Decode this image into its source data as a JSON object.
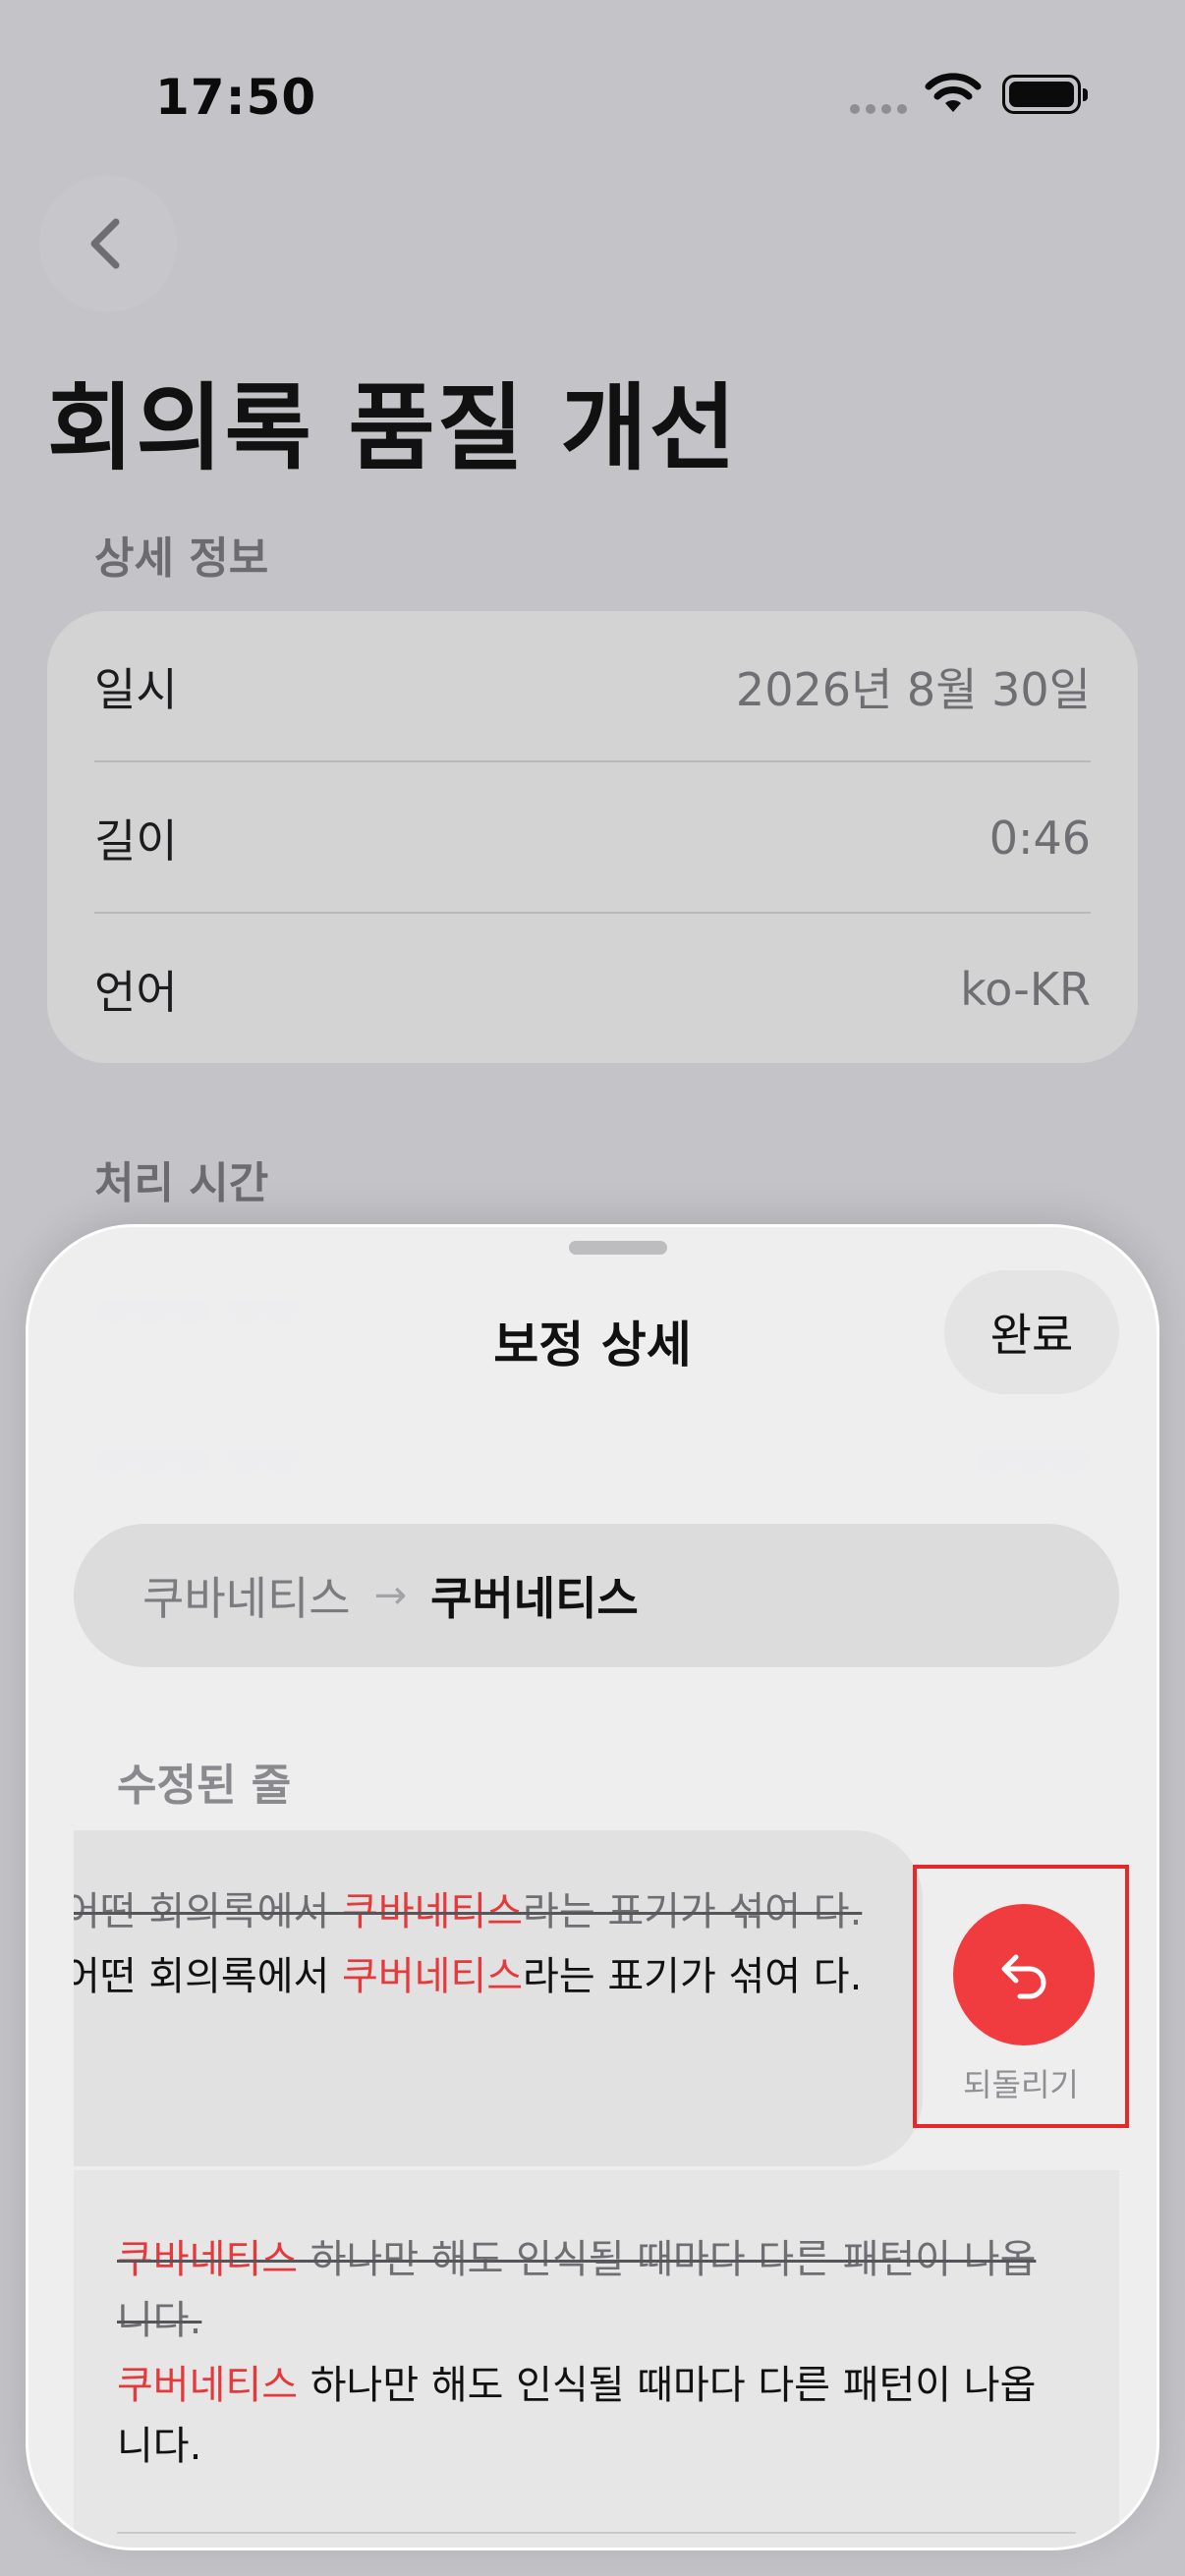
{
  "status_bar": {
    "time": "17:50"
  },
  "nav": {
    "back_icon": "chevron-left-icon"
  },
  "page": {
    "title": "회의록 품질 개선"
  },
  "details": {
    "header": "상세 정보",
    "rows": [
      {
        "label": "일시",
        "value": "2026년 8월 30일"
      },
      {
        "label": "길이",
        "value": "0:46"
      },
      {
        "label": "언어",
        "value": "ko-KR"
      }
    ]
  },
  "processing": {
    "header": "처리 시간"
  },
  "sheet": {
    "title": "보정 상세",
    "done_label": "완료",
    "correction": {
      "from": "쿠바네티스",
      "arrow": "→",
      "to": "쿠버네티스"
    },
    "section_header": "수정된 줄",
    "undo": {
      "label": "되돌리기",
      "icon": "undo-arrow-icon",
      "color": "#f03c3f"
    },
    "lines": [
      {
        "original": {
          "pre": "어떤 회의록에서 ",
          "term": "쿠바네티스",
          "post": "라는 표기가 섞여 다."
        },
        "fixed": {
          "pre": "어떤 회의록에서 ",
          "term": "쿠버네티스",
          "post": "라는 표기가 섞여 다."
        }
      },
      {
        "original": {
          "pre": "",
          "term": "쿠바네티스",
          "post": " 하나만 해도 인식될 때마다 다른 패턴이 나옵니다."
        },
        "fixed": {
          "pre": "",
          "term": "쿠버네티스",
          "post": " 하나만 해도 인식될 때마다 다른 패턴이 나옵니다."
        }
      }
    ]
  }
}
